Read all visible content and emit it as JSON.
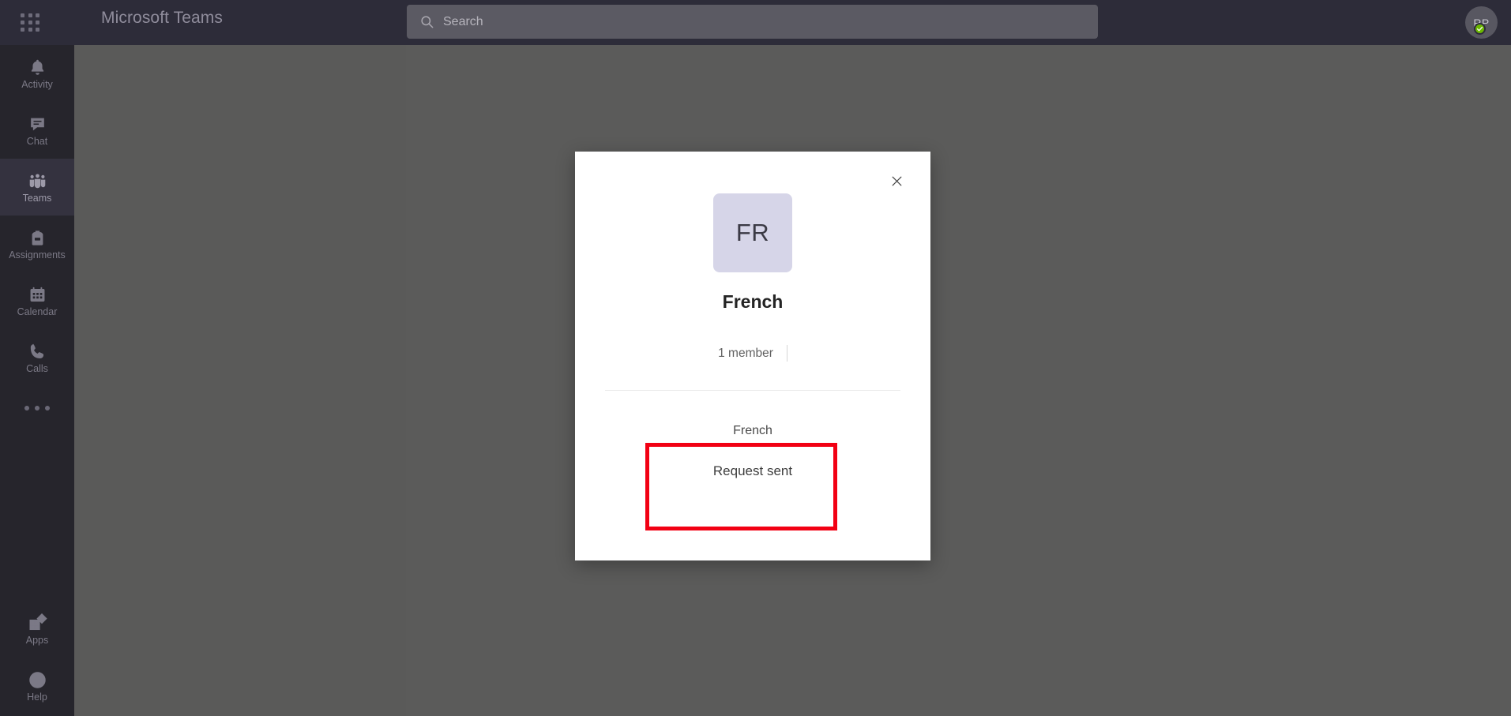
{
  "app": {
    "title": "Microsoft Teams",
    "waffle_icon": "app-launcher-grid-icon"
  },
  "search": {
    "placeholder": "Search",
    "icon": "search-icon",
    "value": ""
  },
  "user": {
    "initials": "RP",
    "presence": "Available",
    "presence_icon": "check-icon",
    "presence_color": "#6bb700"
  },
  "rail": {
    "items": [
      {
        "label": "Activity",
        "icon": "bell-icon",
        "active": false
      },
      {
        "label": "Chat",
        "icon": "chat-icon",
        "active": false
      },
      {
        "label": "Teams",
        "icon": "teams-icon",
        "active": true
      },
      {
        "label": "Assignments",
        "icon": "backpack-icon",
        "active": false
      },
      {
        "label": "Calendar",
        "icon": "calendar-icon",
        "active": false
      },
      {
        "label": "Calls",
        "icon": "phone-icon",
        "active": false
      }
    ],
    "more_label": "More options",
    "more_icon": "ellipsis-icon",
    "bottom_items": [
      {
        "label": "Apps",
        "icon": "apps-icon"
      },
      {
        "label": "Help",
        "icon": "help-circle-icon"
      }
    ]
  },
  "modal": {
    "close_icon": "close-icon",
    "avatar_initials": "FR",
    "avatar_color": "#d6d5e8",
    "team_name": "French",
    "member_count": "1 member",
    "channel_name": "French",
    "status_text": "Request sent"
  },
  "annotation": {
    "color": "#f20013",
    "target": "Request sent"
  }
}
